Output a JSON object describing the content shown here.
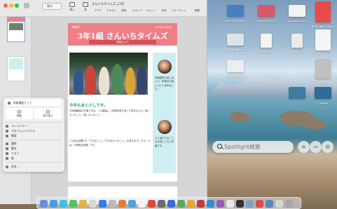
{
  "window": {
    "doc_title": "さんいちタイムズ_12月",
    "view_label": "表示",
    "toolbar": [
      "表示",
      "挿入",
      "表",
      "グラフ",
      "テキスト",
      "図形",
      "メディア",
      "コメント",
      "共有",
      "フォーマット",
      "書類"
    ]
  },
  "page": {
    "section_label": "特集号",
    "date_label": "2023年12月1日",
    "title": "3年1組 さんいちタイムズ",
    "subtitle": "学級だより",
    "headline": "今年もあと少しです。",
    "body": [
      "今年度最後の行事となる、この機会に１年間を振り返って見ませんか。楽しかったこと、悲しかったこと、…",
      "1つ目の目標でも「できること」「できなかったこと」を書きます。もう一つは「3学期の目標」です。"
    ],
    "right_col_top": "学級委員の話し合いで、年間の行事について決めました…",
    "right_col_bottom": "人と協力することを大切にしたい学級です。"
  },
  "popover": {
    "header": "学級通信として",
    "btn_left": "検証",
    "btn_right": "書き換え",
    "items": [
      "フレンドリー",
      "プロフェッショナル",
      "簡潔",
      "要約",
      "要点",
      "リスト",
      "表",
      "作文..."
    ]
  },
  "desktop_icons": [
    {
      "label": "Screenshot 2023-…",
      "color": "#4a7fbf"
    },
    {
      "label": "Screenshot 2023-…",
      "color": "#d8596a"
    },
    {
      "label": "Screenshot 2023-…",
      "color": "#f2f2f2"
    },
    {
      "label": "学年の通信…pages",
      "color": "#e94a4a"
    },
    {
      "label": "背景を準備.key",
      "color": "#dfe3e8"
    },
    {
      "label": "資料01.pdf",
      "color": "#f4f4f4"
    },
    {
      "label": "資料02.pdf",
      "color": "#eaeaea"
    },
    {
      "label": "学年だより.pages",
      "color": "#f5f5f5"
    },
    {
      "label": "Interview.key",
      "color": "#ededed"
    },
    {
      "label": "ハイ…",
      "color": "#c0c0c0"
    },
    {
      "label": "…",
      "color": "#3d7da0"
    },
    {
      "label": "…pages",
      "color": "#2e6d95"
    }
  ],
  "spotlight": {
    "placeholder": "Spotlight検索"
  },
  "dock_colors": [
    "#6b8fd4",
    "#4a9be6",
    "#3ec1e0",
    "#5bbf5e",
    "#e6b43d",
    "#d8d8d8",
    "#2f7ee6",
    "#b9b9b9",
    "#e87b3a",
    "#4ba3de",
    "#f2f2f2",
    "#e2463d",
    "#6c6c6c",
    "#3a6bd6",
    "#5aa85e",
    "#e8a540",
    "#c03b3b",
    "#2d8ed8",
    "#9b59b6",
    "#eaeaea",
    "#333333",
    "#7fa0c2",
    "#d94f4f",
    "#5f84c0",
    "#d6d6d6",
    "#a7a7a7"
  ]
}
